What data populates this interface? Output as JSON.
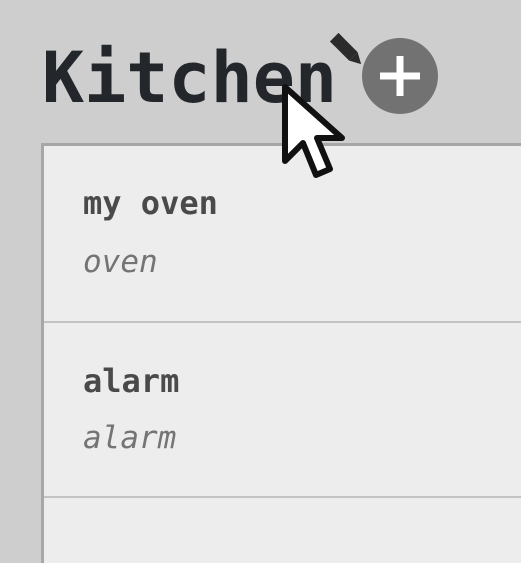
{
  "room": {
    "title": "Kitchen"
  },
  "icons": {
    "edit": "pencil-icon",
    "add": "plus-icon",
    "cursor": "mouse-pointer-icon"
  },
  "devices": [
    {
      "name": "my oven",
      "type": "oven"
    },
    {
      "name": "alarm",
      "type": "alarm"
    }
  ],
  "colors": {
    "background": "#cecece",
    "panel": "#ededed",
    "title": "#23272b",
    "add_button": "#727272"
  }
}
